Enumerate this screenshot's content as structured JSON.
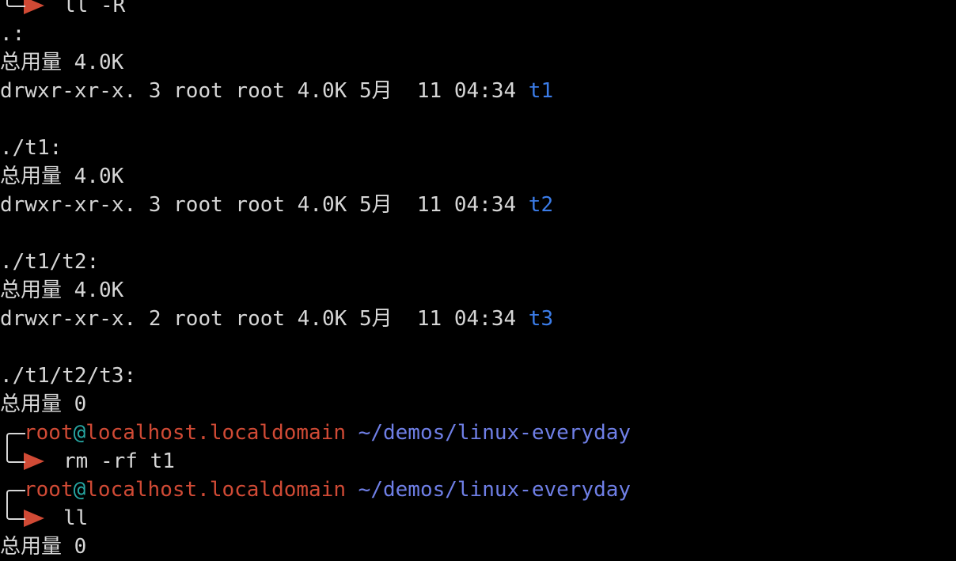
{
  "colors": {
    "background": "#000000",
    "text": "#d6d6d6",
    "directory": "#3b7ce8",
    "prompt_user_host": "#d04a35",
    "prompt_at": "#27a8a4",
    "prompt_path": "#6f7fe6"
  },
  "lines": [
    {
      "kind": "prompt-bot",
      "cmd": "ll -R"
    },
    {
      "kind": "text",
      "text": ".:"
    },
    {
      "kind": "text",
      "text": "总用量 4.0K"
    },
    {
      "kind": "ls",
      "text": "drwxr-xr-x. 3 root root 4.0K 5月  11 04:34 ",
      "name": "t1"
    },
    {
      "kind": "blank"
    },
    {
      "kind": "text",
      "text": "./t1:"
    },
    {
      "kind": "text",
      "text": "总用量 4.0K"
    },
    {
      "kind": "ls",
      "text": "drwxr-xr-x. 3 root root 4.0K 5月  11 04:34 ",
      "name": "t2"
    },
    {
      "kind": "blank"
    },
    {
      "kind": "text",
      "text": "./t1/t2:"
    },
    {
      "kind": "text",
      "text": "总用量 4.0K"
    },
    {
      "kind": "ls",
      "text": "drwxr-xr-x. 2 root root 4.0K 5月  11 04:34 ",
      "name": "t3"
    },
    {
      "kind": "blank"
    },
    {
      "kind": "text",
      "text": "./t1/t2/t3:"
    },
    {
      "kind": "text",
      "text": "总用量 0"
    },
    {
      "kind": "prompt-top",
      "user": "root",
      "at": "@",
      "host": "localhost.localdomain",
      "path": "~/demos/linux-everyday"
    },
    {
      "kind": "prompt-bot",
      "cmd": "rm -rf t1"
    },
    {
      "kind": "prompt-top",
      "user": "root",
      "at": "@",
      "host": "localhost.localdomain",
      "path": "~/demos/linux-everyday"
    },
    {
      "kind": "prompt-bot",
      "cmd": "ll"
    },
    {
      "kind": "text",
      "text": "总用量 0"
    }
  ]
}
